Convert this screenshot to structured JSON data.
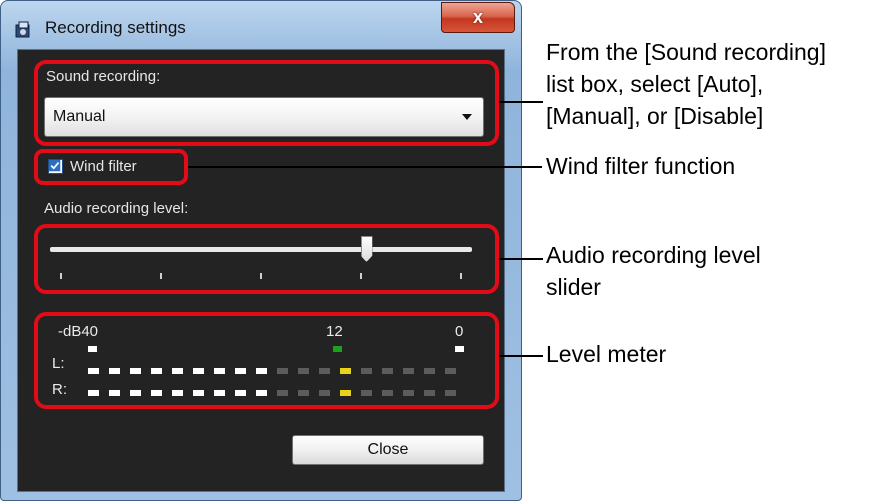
{
  "window": {
    "title": "Recording settings",
    "close_glyph": "x"
  },
  "sound_recording": {
    "label": "Sound recording:",
    "selected": "Manual"
  },
  "wind_filter": {
    "label": "Wind filter",
    "checked": true
  },
  "audio_level": {
    "label": "Audio recording level:",
    "slider_fraction": 0.75,
    "tick_count": 5
  },
  "level_meter": {
    "scale_labels": [
      "-dB40",
      "12",
      "0"
    ],
    "channels": [
      "L:",
      "R:"
    ],
    "lit_segments": 9,
    "total_segments": 18,
    "yellow_segment_index": 12
  },
  "buttons": {
    "close": "Close"
  },
  "callouts": {
    "sound_recording": [
      "From the [Sound recording]",
      "list box, select [Auto],",
      "[Manual], or [Disable]"
    ],
    "wind_filter": "Wind filter function",
    "slider": [
      "Audio recording level",
      "slider"
    ],
    "meter": "Level meter"
  },
  "colors": {
    "highlight_box": "#e30b17",
    "client_bg": "#232323",
    "segment_on": "#ffffff",
    "segment_off": "#5c5c5c",
    "segment_yellow": "#e8d21a",
    "peak_green": "#19a31a"
  }
}
